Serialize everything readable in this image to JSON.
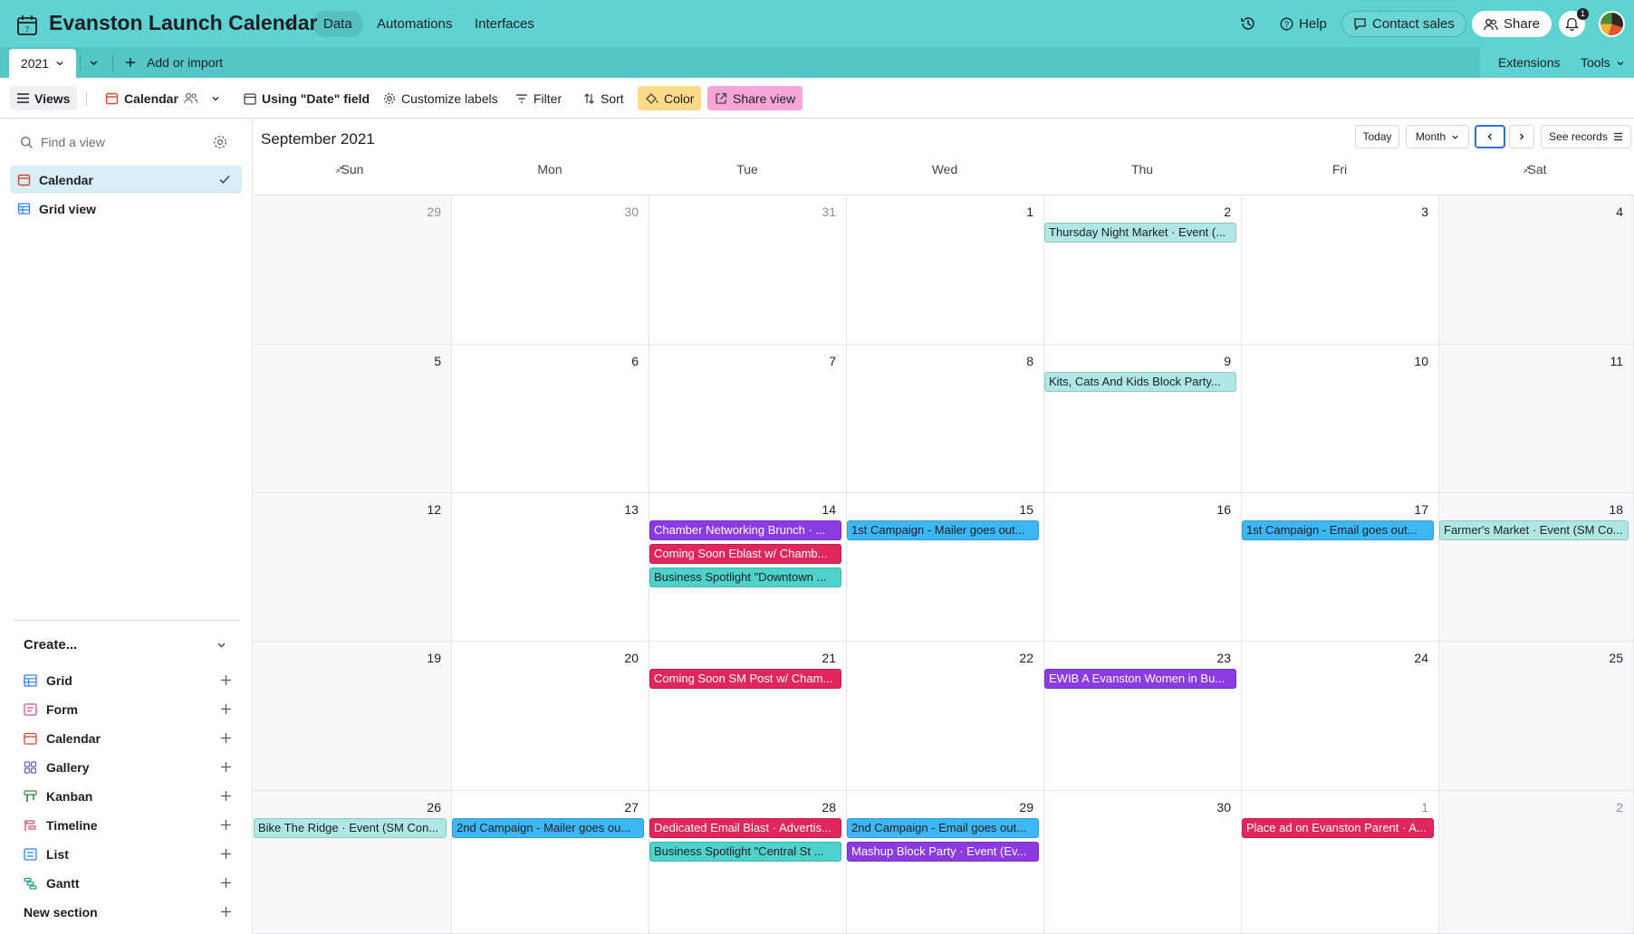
{
  "app": {
    "base_title": "Evanston Launch Calendar",
    "nav_tabs": [
      "Data",
      "Automations",
      "Interfaces"
    ],
    "help_label": "Help",
    "contact_sales_label": "Contact sales",
    "share_label": "Share",
    "notification_count": "1"
  },
  "tabbar": {
    "table_name": "2021",
    "add_import_label": "Add or import",
    "extensions_label": "Extensions",
    "tools_label": "Tools"
  },
  "viewbar": {
    "views_label": "Views",
    "current_view_label": "Calendar",
    "date_field_label": "Using \"Date\" field",
    "customize_labels": "Customize labels",
    "filter_label": "Filter",
    "sort_label": "Sort",
    "color_label": "Color",
    "share_view_label": "Share view"
  },
  "sidebar": {
    "find_placeholder": "Find a view",
    "views": [
      {
        "label": "Calendar",
        "active": true
      },
      {
        "label": "Grid view",
        "active": false
      }
    ],
    "create_heading": "Create...",
    "create_items": [
      "Grid",
      "Form",
      "Calendar",
      "Gallery",
      "Kanban",
      "Timeline",
      "List",
      "Gantt",
      "New section"
    ]
  },
  "calendar": {
    "month": "September",
    "year": "2021",
    "today_label": "Today",
    "range_label": "Month",
    "see_records_label": "See records",
    "weekdays": [
      "Sun",
      "Mon",
      "Tue",
      "Wed",
      "Thu",
      "Fri",
      "Sat"
    ],
    "weeks": [
      [
        {
          "day": "29",
          "muted": true,
          "events": []
        },
        {
          "day": "30",
          "muted": true,
          "events": []
        },
        {
          "day": "31",
          "muted": true,
          "events": []
        },
        {
          "day": "1",
          "muted": false,
          "events": []
        },
        {
          "day": "2",
          "muted": false,
          "events": [
            {
              "title": "Thursday Night Market · Event (...",
              "color": "light-teal"
            }
          ]
        },
        {
          "day": "3",
          "muted": false,
          "events": []
        },
        {
          "day": "4",
          "muted": false,
          "events": []
        }
      ],
      [
        {
          "day": "5",
          "muted": false,
          "events": []
        },
        {
          "day": "6",
          "muted": false,
          "events": []
        },
        {
          "day": "7",
          "muted": false,
          "events": []
        },
        {
          "day": "8",
          "muted": false,
          "events": []
        },
        {
          "day": "9",
          "muted": false,
          "events": [
            {
              "title": "Kits, Cats And Kids Block Party...",
              "color": "light-teal"
            }
          ]
        },
        {
          "day": "10",
          "muted": false,
          "events": []
        },
        {
          "day": "11",
          "muted": false,
          "events": []
        }
      ],
      [
        {
          "day": "12",
          "muted": false,
          "events": []
        },
        {
          "day": "13",
          "muted": false,
          "events": []
        },
        {
          "day": "14",
          "muted": false,
          "events": [
            {
              "title": "Chamber Networking Brunch · ...",
              "color": "purple"
            },
            {
              "title": "Coming Soon Eblast w/ Chamb...",
              "color": "red"
            },
            {
              "title": "Business Spotlight \"Downtown ...",
              "color": "teal"
            }
          ]
        },
        {
          "day": "15",
          "muted": false,
          "events": [
            {
              "title": "1st Campaign - Mailer goes out...",
              "color": "blue"
            }
          ]
        },
        {
          "day": "16",
          "muted": false,
          "events": []
        },
        {
          "day": "17",
          "muted": false,
          "events": [
            {
              "title": "1st Campaign - Email goes out...",
              "color": "blue"
            }
          ]
        },
        {
          "day": "18",
          "muted": false,
          "events": [
            {
              "title": "Farmer's Market · Event (SM Co...",
              "color": "light-teal"
            }
          ]
        }
      ],
      [
        {
          "day": "19",
          "muted": false,
          "events": []
        },
        {
          "day": "20",
          "muted": false,
          "events": []
        },
        {
          "day": "21",
          "muted": false,
          "events": [
            {
              "title": "Coming Soon SM Post w/ Cham...",
              "color": "red"
            }
          ]
        },
        {
          "day": "22",
          "muted": false,
          "events": []
        },
        {
          "day": "23",
          "muted": false,
          "events": [
            {
              "title": "EWIB A Evanston Women in Bu...",
              "color": "purple"
            }
          ]
        },
        {
          "day": "24",
          "muted": false,
          "events": []
        },
        {
          "day": "25",
          "muted": false,
          "events": []
        }
      ],
      [
        {
          "day": "26",
          "muted": false,
          "events": [
            {
              "title": "Bike The Ridge · Event (SM Con...",
              "color": "light-teal"
            }
          ]
        },
        {
          "day": "27",
          "muted": false,
          "events": [
            {
              "title": "2nd Campaign - Mailer goes ou...",
              "color": "blue"
            }
          ]
        },
        {
          "day": "28",
          "muted": false,
          "events": [
            {
              "title": "Dedicated Email Blast · Advertis...",
              "color": "red"
            },
            {
              "title": "Business Spotlight \"Central St ...",
              "color": "teal"
            }
          ]
        },
        {
          "day": "29",
          "muted": false,
          "events": [
            {
              "title": "2nd Campaign - Email goes out...",
              "color": "blue"
            },
            {
              "title": "Mashup Block Party · Event (Ev...",
              "color": "purple"
            }
          ]
        },
        {
          "day": "30",
          "muted": false,
          "events": []
        },
        {
          "day": "1",
          "muted": true,
          "events": [
            {
              "title": "Place ad on Evanston Parent · A...",
              "color": "red"
            }
          ]
        },
        {
          "day": "2",
          "muted": true,
          "events": []
        }
      ]
    ]
  },
  "colors": {
    "header": "#5fd3d2",
    "light-teal": "#aee7e4",
    "teal": "#4fd2cb",
    "blue": "#3db7f3",
    "purple": "#8a3be4",
    "red": "#e0265a"
  }
}
